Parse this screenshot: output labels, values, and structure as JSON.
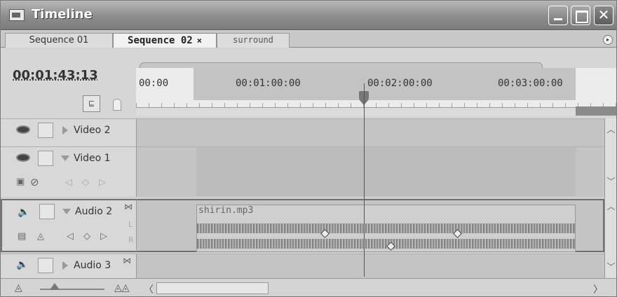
{
  "window": {
    "title": "Timeline"
  },
  "tabs": [
    {
      "label": "Sequence 01"
    },
    {
      "label": "Sequence 02",
      "close": "×"
    },
    {
      "label": "surround"
    }
  ],
  "timecode": "00:01:43:13",
  "ruler": {
    "labels": [
      "00:00",
      "00:01:00:00",
      "00:02:00:00",
      "00:03:00:00"
    ]
  },
  "tracks": {
    "video2": {
      "name": "Video 2"
    },
    "video1": {
      "name": "Video 1"
    },
    "audio2": {
      "name": "Audio 2",
      "channels": [
        "L",
        "R"
      ]
    },
    "audio3": {
      "name": "Audio 3"
    }
  },
  "clip": {
    "name": "shirin.mp3"
  },
  "icons": {
    "window": "timeline-icon",
    "snap": "snap-icon",
    "marker": "marker-icon",
    "eye": "eye-icon",
    "speaker": "speaker-icon",
    "keyframe": "keyframe-icon"
  },
  "colors": {
    "background": "#d0d0d0",
    "titlebar": "#8d8d8d",
    "clip": "#cfcfcf"
  }
}
